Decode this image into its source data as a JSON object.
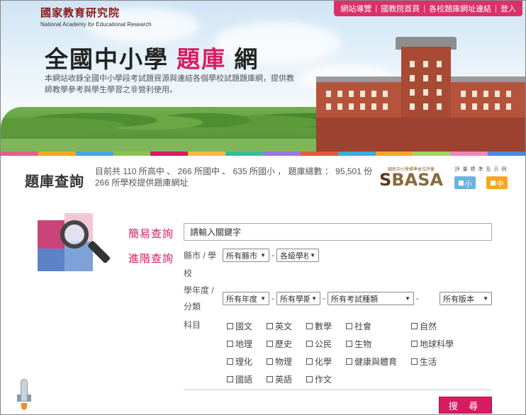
{
  "header": {
    "logo_cn": "國家教育研究院",
    "logo_en_pre": "National Academy ",
    "logo_en_italic": "for",
    "logo_en_post": " Educational Research",
    "nav": [
      "網站導覽",
      "國教院首頁",
      "各校題庫網址連結",
      "登入"
    ],
    "title_a": "全國中小學 ",
    "title_hl": "題庫",
    "title_b": " 網",
    "description": "本網站收錄全國中小學段考試題資源與連結各個學校試題題庫網，提供教師教學參考與學生學習之非營利使用。"
  },
  "colors": {
    "accent": "#d81b60",
    "strip": [
      "#e85d8a",
      "#f5a623",
      "#4aa3df",
      "#8cc152",
      "#d81b60",
      "#f6bb42",
      "#37bc9b",
      "#967adc",
      "#e9573f",
      "#3bafda",
      "#f5a623",
      "#a0d468",
      "#ec87c0",
      "#4a89dc"
    ]
  },
  "query": {
    "title": "題庫查詢",
    "stats_line1": "目前共 110 所高中 、 266 所國中 、 635 所國小 ， 題庫總數 ： 95,501 份",
    "stats_line2": "266 所學校提供題庫網址",
    "sbasa_sub": "國民中小學標準本位評量",
    "sbasa_s": "S",
    "sbasa_rest": "BASA",
    "grade_legend_title": "評 量 標 準 及 示 例",
    "grade_small": "小",
    "grade_mid": "中",
    "grade_small_color": "#6ab3e0",
    "grade_mid_color": "#f5a623"
  },
  "search": {
    "simple_label": "簡易查詢",
    "advanced_label": "進階查詢",
    "keyword_placeholder": "請輸入關鍵字",
    "city_label": "縣市 / 學",
    "city_label2": "校",
    "city_select": "所有縣市",
    "school_select": "各級學校",
    "year_label": "學年度 /",
    "year_label2": "分類",
    "year_select": "所有年度",
    "semester_select": "所有學期",
    "exam_select": "所有考試種類",
    "version_select": "所有版本",
    "subject_label": "科目",
    "subjects": [
      "國文",
      "英文",
      "數學",
      "社會",
      "自然",
      "地理",
      "歷史",
      "公民",
      "生物",
      "地球科學",
      "理化",
      "物理",
      "化學",
      "健康與體育",
      "生活",
      "國語",
      "英語",
      "作文"
    ],
    "search_button": "搜 尋"
  }
}
